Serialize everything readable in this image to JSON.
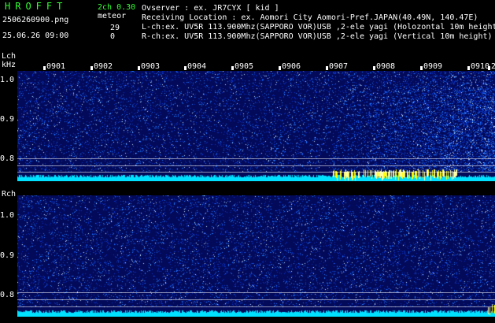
{
  "header": {
    "logo_text": "HROFFT",
    "filename": "2506260900.png",
    "datetime": "25.06.26 09:00",
    "channel_label": "2ch 0.30",
    "meteor_label": "meteor",
    "meteor_count_l": "29",
    "meteor_count_r": "0",
    "observer": "Ovserver                 : ex. JR7CYX [ kid ]",
    "location": "Receiving Location : ex. Aomori City Aomori-Pref.JAPAN(40.49N, 140.47E)",
    "lch_info": "L-ch:ex. UV5R 113.900Mhz(SAPPORO VOR)USB ,2-ele yagi (Holozontal 10m height",
    "rch_info": "R-ch:ex. UV5R 113.900Mhz(SAPPORO VOR)USB ,2-ele yagi (Vertical 10m height)"
  },
  "lch": {
    "label": "Lch",
    "unit": "kHz",
    "time_labels": [
      "0901",
      "0902",
      "0903",
      "0904",
      "0905",
      "0906",
      "0907",
      "0908",
      "0909",
      "0910",
      "2"
    ],
    "y_labels": [
      "1.0",
      "0.9",
      "0.8"
    ]
  },
  "rch": {
    "label": "Rch",
    "y_labels": [
      "1.0",
      "0.9",
      "0.8"
    ]
  },
  "colors": {
    "background": "#000000",
    "waterfall_bg": "#030a5a",
    "noise_bar": "#00e0ff",
    "meteor_hit": "#ffff00",
    "text_green": "#33ff33"
  }
}
